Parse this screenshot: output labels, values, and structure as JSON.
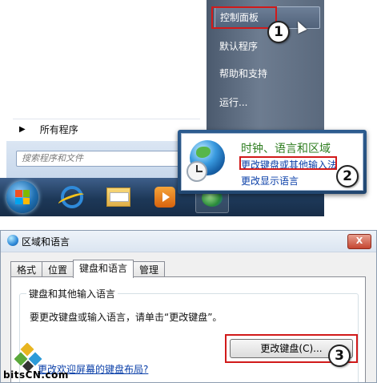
{
  "start_menu": {
    "right_items": [
      "控制面板",
      "默认程序",
      "帮助和支持",
      "运行..."
    ],
    "all_programs": "所有程序",
    "search_placeholder": "搜索程序和文件"
  },
  "popup": {
    "title": "时钟、语言和区域",
    "link_change_keyboard": "更改键盘或其他输入法",
    "link_change_display_language": "更改显示语言"
  },
  "steps": [
    "1",
    "2",
    "3"
  ],
  "dialog": {
    "title": "区域和语言",
    "close_label": "X",
    "tabs": [
      "格式",
      "位置",
      "键盘和语言",
      "管理"
    ],
    "active_tab_index": 2,
    "group_title": "键盘和其他输入语言",
    "group_desc": "要更改键盘或输入语言，请单击“更改键盘”。",
    "change_keyboard_button": "更改键盘(C)...",
    "bottom_link": "更改欢迎屏幕的键盘布局?"
  },
  "watermark": {
    "text": "bitsCN.com"
  },
  "colors": {
    "highlight_red": "#d11a1a",
    "link_blue": "#0a3fa8",
    "popup_title_green": "#2e7d1f"
  }
}
